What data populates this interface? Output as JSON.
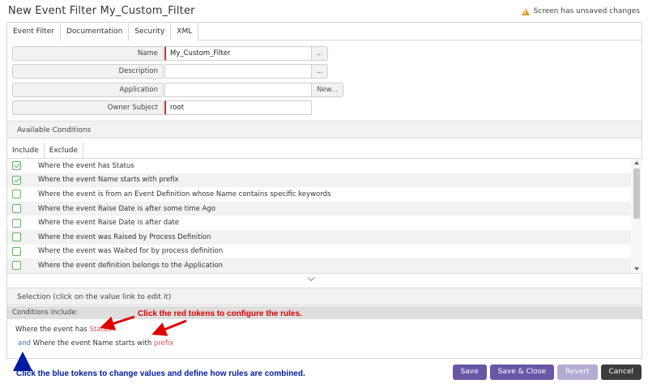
{
  "window": {
    "title": "New Event Filter My_Custom_Filter",
    "unsaved_notice": "Screen has unsaved changes"
  },
  "tabs": [
    "Event Filter",
    "Documentation",
    "Security",
    "XML"
  ],
  "form": {
    "name_label": "Name",
    "name_value": "My_Custom_Filter",
    "name_button": "...",
    "description_label": "Description",
    "description_value": "",
    "description_button": "...",
    "application_label": "Application",
    "application_value": "",
    "application_button": "New...",
    "owner_label": "Owner Subject",
    "owner_value": "root"
  },
  "available_conditions": {
    "header": "Available Conditions",
    "subtabs": [
      "Include",
      "Exclude"
    ],
    "items": [
      {
        "label": "Where the event has Status",
        "checked": true
      },
      {
        "label": "Where the event Name starts with prefix",
        "checked": true
      },
      {
        "label": "Where the event is from an Event Definition whose Name contains specific keywords",
        "checked": false
      },
      {
        "label": "Where the event Raise Date is after some time Ago",
        "checked": false
      },
      {
        "label": "Where the event Raise Date is after date",
        "checked": false
      },
      {
        "label": "Where the event was Raised by Process Definition",
        "checked": false
      },
      {
        "label": "Where the event was Waited for by process definition",
        "checked": false
      },
      {
        "label": "Where the event definition belongs to the Application",
        "checked": false
      }
    ]
  },
  "selection": {
    "header": "Selection (click on the value link to edit it)",
    "conditions_include_label": "Conditions include:",
    "line1_prefix": "Where the event has ",
    "line1_token": "Status",
    "line2_connector": "and",
    "line2_prefix": " Where the event Name starts with ",
    "line2_token": "prefix"
  },
  "annotations": {
    "red": "Click the red tokens to configure the rules.",
    "blue": "Click the blue tokens to change values and define how rules are combined.",
    "red_color": "#e00000",
    "blue_color": "#001aa0"
  },
  "buttons": {
    "save": "Save",
    "save_close": "Save & Close",
    "revert": "Revert",
    "cancel": "Cancel"
  },
  "colors": {
    "accent": "#6a56a6",
    "accent_disabled": "#b3abd4",
    "check": "#5cb85c",
    "required": "#c0392b",
    "warning": "#e0962a"
  }
}
